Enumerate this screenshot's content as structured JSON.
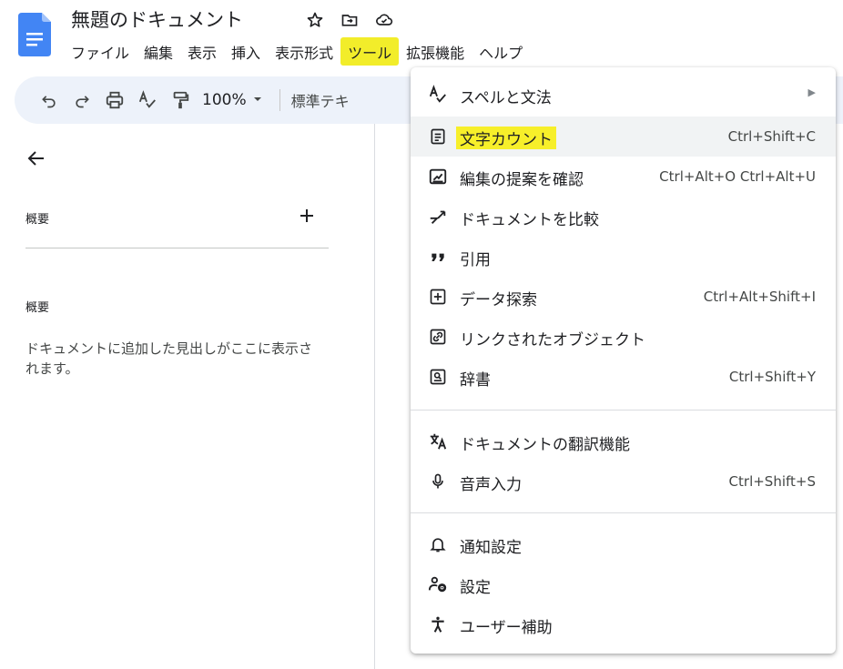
{
  "document": {
    "title": "無題のドキュメント"
  },
  "menubar": {
    "items": [
      {
        "label": "ファイル"
      },
      {
        "label": "編集"
      },
      {
        "label": "表示"
      },
      {
        "label": "挿入"
      },
      {
        "label": "表示形式"
      },
      {
        "label": "ツール"
      },
      {
        "label": "拡張機能"
      },
      {
        "label": "ヘルプ"
      }
    ]
  },
  "toolbar": {
    "zoom": "100%",
    "style": "標準テキ"
  },
  "outline": {
    "summary_heading": "概要",
    "outline_heading": "概要",
    "empty_hint": "ドキュメントに追加した見出しがここに表示されます。"
  },
  "tools_menu": {
    "items": [
      {
        "label": "スペルと文法",
        "shortcut": "",
        "icon": "spellcheck-icon",
        "submenu": true
      },
      {
        "label": "文字カウント",
        "shortcut": "Ctrl+Shift+C",
        "icon": "word-count-icon"
      },
      {
        "label": "編集の提案を確認",
        "shortcut": "Ctrl+Alt+O Ctrl+Alt+U",
        "icon": "review-suggestions-icon"
      },
      {
        "label": "ドキュメントを比較",
        "shortcut": "",
        "icon": "compare-icon"
      },
      {
        "label": "引用",
        "shortcut": "",
        "icon": "quote-icon"
      },
      {
        "label": "データ探索",
        "shortcut": "Ctrl+Alt+Shift+I",
        "icon": "explore-icon"
      },
      {
        "label": "リンクされたオブジェクト",
        "shortcut": "",
        "icon": "linked-objects-icon"
      },
      {
        "label": "辞書",
        "shortcut": "Ctrl+Shift+Y",
        "icon": "dictionary-icon"
      },
      {
        "label": "ドキュメントの翻訳機能",
        "shortcut": "",
        "icon": "translate-icon"
      },
      {
        "label": "音声入力",
        "shortcut": "Ctrl+Shift+S",
        "icon": "microphone-icon"
      },
      {
        "label": "通知設定",
        "shortcut": "",
        "icon": "bell-icon"
      },
      {
        "label": "設定",
        "shortcut": "",
        "icon": "settings-icon"
      },
      {
        "label": "ユーザー補助",
        "shortcut": "",
        "icon": "accessibility-icon"
      }
    ]
  },
  "colors": {
    "highlight": "#f7ef2a",
    "toolbar_bg": "#edf2fa",
    "docs_blue": "#4285f4"
  }
}
